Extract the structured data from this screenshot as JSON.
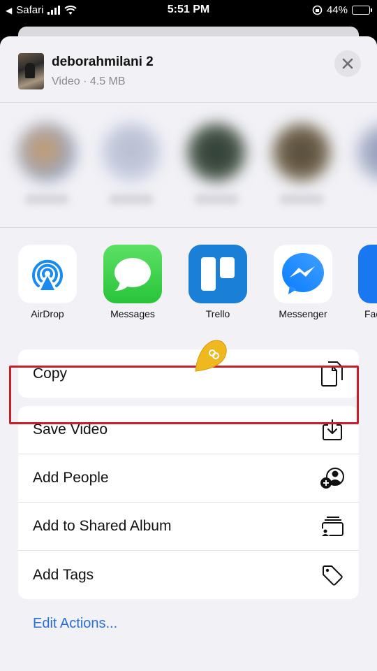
{
  "status_bar": {
    "carrier": "Safari",
    "time": "5:51 PM",
    "battery": "44%",
    "battery_level": 0.44
  },
  "sheet": {
    "title": "deborahmilani 2",
    "subtitle": "Video · 4.5 MB"
  },
  "apps": [
    {
      "label": "AirDrop",
      "icon": "airdrop-icon"
    },
    {
      "label": "Messages",
      "icon": "messages-icon"
    },
    {
      "label": "Trello",
      "icon": "trello-icon"
    },
    {
      "label": "Messenger",
      "icon": "messenger-icon"
    },
    {
      "label": "Fac",
      "icon": "facebook-icon"
    }
  ],
  "actions_top": [
    {
      "label": "Copy",
      "icon": "copy-icon"
    }
  ],
  "actions_main": [
    {
      "label": "Save Video",
      "icon": "save-icon"
    },
    {
      "label": "Add People",
      "icon": "add-people-icon"
    },
    {
      "label": "Add to Shared Album",
      "icon": "shared-album-icon"
    },
    {
      "label": "Add Tags",
      "icon": "tag-icon"
    }
  ],
  "edit_actions": "Edit Actions...",
  "colors": {
    "sheet_bg": "#f1f1f6",
    "highlight": "#c8202a",
    "link": "#2a6fd6",
    "pin": "#f0b81f"
  }
}
